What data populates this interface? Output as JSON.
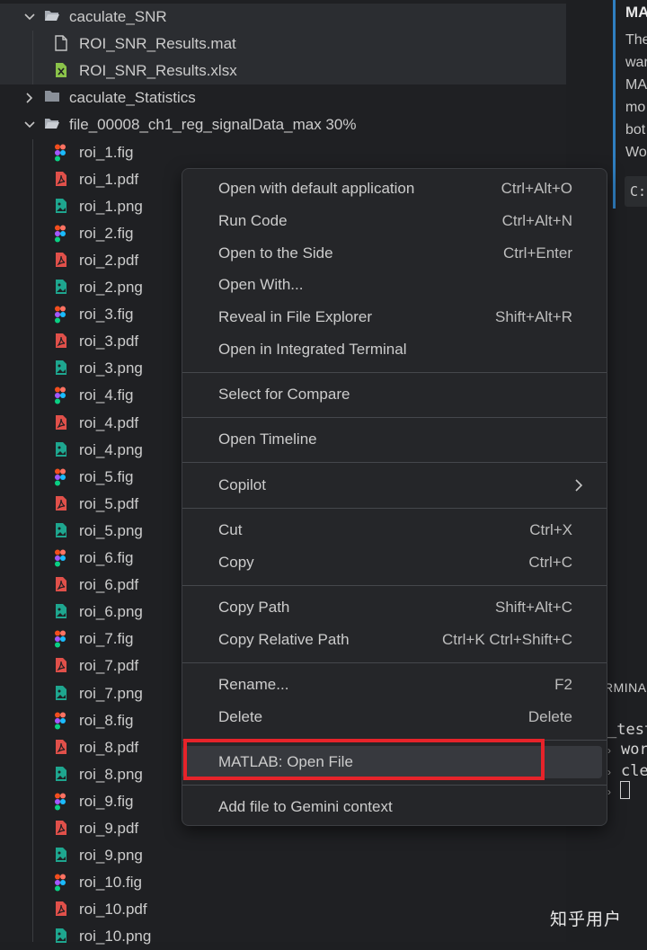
{
  "explorer": {
    "rows": [
      {
        "label": "caculate_SNR",
        "kind": "folder",
        "expanded": true,
        "depth": 0,
        "icon": "folder-open-icon"
      },
      {
        "label": "ROI_SNR_Results.mat",
        "kind": "file",
        "depth": 1,
        "icon": "file-icon"
      },
      {
        "label": "ROI_SNR_Results.xlsx",
        "kind": "file",
        "depth": 1,
        "icon": "excel-icon"
      },
      {
        "label": "caculate_Statistics",
        "kind": "folder",
        "expanded": false,
        "depth": 0,
        "icon": "folder-icon"
      },
      {
        "label": "file_00008_ch1_reg_signalData_max 30%",
        "kind": "folder",
        "expanded": true,
        "depth": 0,
        "icon": "folder-open-icon"
      },
      {
        "label": "roi_1.fig",
        "kind": "file",
        "depth": 1,
        "icon": "figma-icon"
      },
      {
        "label": "roi_1.pdf",
        "kind": "file",
        "depth": 1,
        "icon": "pdf-icon"
      },
      {
        "label": "roi_1.png",
        "kind": "file",
        "depth": 1,
        "icon": "image-icon"
      },
      {
        "label": "roi_2.fig",
        "kind": "file",
        "depth": 1,
        "icon": "figma-icon"
      },
      {
        "label": "roi_2.pdf",
        "kind": "file",
        "depth": 1,
        "icon": "pdf-icon"
      },
      {
        "label": "roi_2.png",
        "kind": "file",
        "depth": 1,
        "icon": "image-icon"
      },
      {
        "label": "roi_3.fig",
        "kind": "file",
        "depth": 1,
        "icon": "figma-icon"
      },
      {
        "label": "roi_3.pdf",
        "kind": "file",
        "depth": 1,
        "icon": "pdf-icon"
      },
      {
        "label": "roi_3.png",
        "kind": "file",
        "depth": 1,
        "icon": "image-icon"
      },
      {
        "label": "roi_4.fig",
        "kind": "file",
        "depth": 1,
        "icon": "figma-icon"
      },
      {
        "label": "roi_4.pdf",
        "kind": "file",
        "depth": 1,
        "icon": "pdf-icon"
      },
      {
        "label": "roi_4.png",
        "kind": "file",
        "depth": 1,
        "icon": "image-icon"
      },
      {
        "label": "roi_5.fig",
        "kind": "file",
        "depth": 1,
        "icon": "figma-icon"
      },
      {
        "label": "roi_5.pdf",
        "kind": "file",
        "depth": 1,
        "icon": "pdf-icon"
      },
      {
        "label": "roi_5.png",
        "kind": "file",
        "depth": 1,
        "icon": "image-icon"
      },
      {
        "label": "roi_6.fig",
        "kind": "file",
        "depth": 1,
        "icon": "figma-icon"
      },
      {
        "label": "roi_6.pdf",
        "kind": "file",
        "depth": 1,
        "icon": "pdf-icon"
      },
      {
        "label": "roi_6.png",
        "kind": "file",
        "depth": 1,
        "icon": "image-icon"
      },
      {
        "label": "roi_7.fig",
        "kind": "file",
        "depth": 1,
        "icon": "figma-icon"
      },
      {
        "label": "roi_7.pdf",
        "kind": "file",
        "depth": 1,
        "icon": "pdf-icon"
      },
      {
        "label": "roi_7.png",
        "kind": "file",
        "depth": 1,
        "icon": "image-icon"
      },
      {
        "label": "roi_8.fig",
        "kind": "file",
        "depth": 1,
        "icon": "figma-icon"
      },
      {
        "label": "roi_8.pdf",
        "kind": "file",
        "depth": 1,
        "icon": "pdf-icon"
      },
      {
        "label": "roi_8.png",
        "kind": "file",
        "depth": 1,
        "icon": "image-icon"
      },
      {
        "label": "roi_9.fig",
        "kind": "file",
        "depth": 1,
        "icon": "figma-icon"
      },
      {
        "label": "roi_9.pdf",
        "kind": "file",
        "depth": 1,
        "icon": "pdf-icon"
      },
      {
        "label": "roi_9.png",
        "kind": "file",
        "depth": 1,
        "icon": "image-icon"
      },
      {
        "label": "roi_10.fig",
        "kind": "file",
        "depth": 1,
        "icon": "figma-icon"
      },
      {
        "label": "roi_10.pdf",
        "kind": "file",
        "depth": 1,
        "icon": "pdf-icon"
      },
      {
        "label": "roi_10.png",
        "kind": "file",
        "depth": 1,
        "icon": "image-icon"
      }
    ]
  },
  "doc_panel": {
    "heading": "MA",
    "lines": [
      "The",
      "war",
      "MA",
      "mo",
      "bot",
      "Wo"
    ],
    "code": "C:"
  },
  "terminal": {
    "tab_label": "RMINA",
    "lines": [
      "_test",
      "wor",
      "cle"
    ],
    "prompt_glyph": "›"
  },
  "context_menu": {
    "groups": [
      [
        {
          "label": "Open with default application",
          "shortcut": "Ctrl+Alt+O"
        },
        {
          "label": "Run Code",
          "shortcut": "Ctrl+Alt+N"
        },
        {
          "label": "Open to the Side",
          "shortcut": "Ctrl+Enter"
        },
        {
          "label": "Open With...",
          "shortcut": ""
        },
        {
          "label": "Reveal in File Explorer",
          "shortcut": "Shift+Alt+R"
        },
        {
          "label": "Open in Integrated Terminal",
          "shortcut": ""
        }
      ],
      [
        {
          "label": "Select for Compare",
          "shortcut": ""
        }
      ],
      [
        {
          "label": "Open Timeline",
          "shortcut": ""
        }
      ],
      [
        {
          "label": "Copilot",
          "shortcut": "",
          "submenu": true
        }
      ],
      [
        {
          "label": "Cut",
          "shortcut": "Ctrl+X"
        },
        {
          "label": "Copy",
          "shortcut": "Ctrl+C"
        }
      ],
      [
        {
          "label": "Copy Path",
          "shortcut": "Shift+Alt+C"
        },
        {
          "label": "Copy Relative Path",
          "shortcut": "Ctrl+K Ctrl+Shift+C"
        }
      ],
      [
        {
          "label": "Rename...",
          "shortcut": "F2"
        },
        {
          "label": "Delete",
          "shortcut": "Delete"
        }
      ],
      [
        {
          "label": "MATLAB: Open File",
          "shortcut": "",
          "hovered": true
        }
      ],
      [
        {
          "label": "Add file to Gemini context",
          "shortcut": ""
        }
      ]
    ]
  },
  "colors": {
    "highlight_box": "#e6232a",
    "pdf": "#e0504a",
    "image": "#1ea68f",
    "excel": "#8bc34a",
    "folder": "#8a9099"
  },
  "watermark": "知乎用户"
}
